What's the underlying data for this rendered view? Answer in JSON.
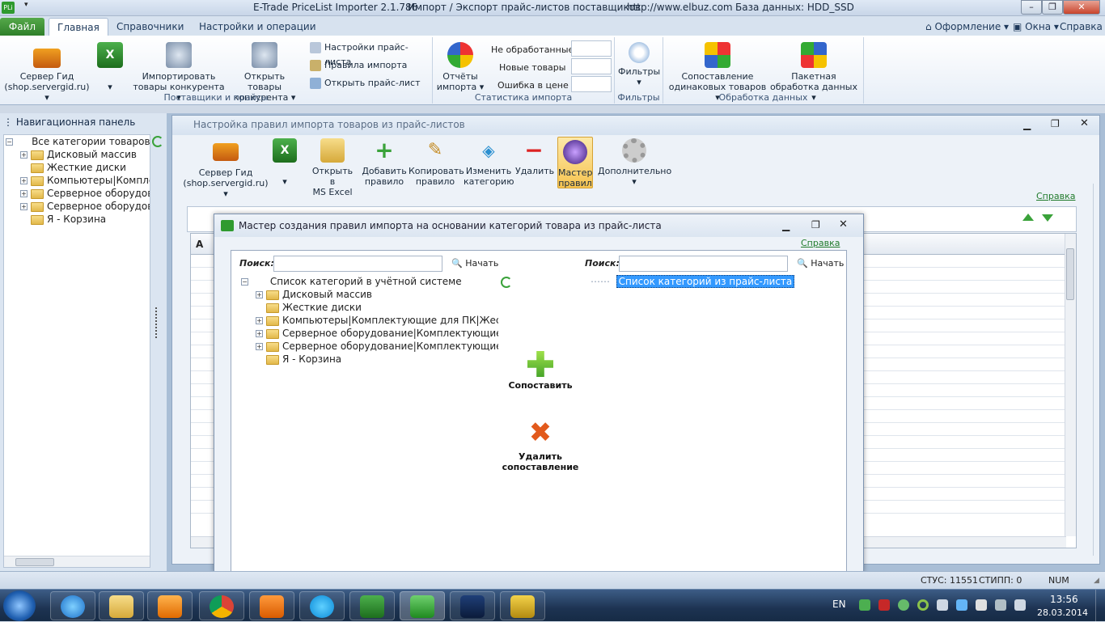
{
  "app": {
    "logo": "PLi",
    "title": "E-Trade PriceList Importer 2.1.786",
    "subtitle": "Импорт / Экспорт прайс-листов поставщиков",
    "url": "http://www.elbuz.com",
    "db": "База данных: HDD_SSD"
  },
  "tabs": {
    "file": "Файл",
    "items": [
      "Главная",
      "Справочники",
      "Настройки и операции"
    ]
  },
  "top_right": {
    "appearance": "Оформление",
    "windows": "Окна",
    "help": "Справка"
  },
  "ribbon": {
    "server_btn": [
      "Сервер Гид",
      "(shop.servergid.ru)"
    ],
    "import_comp": [
      "Импортировать",
      "товары конкурента"
    ],
    "open_comp": [
      "Открыть товары",
      "конкурента"
    ],
    "group1": "Поставщики и прайсы",
    "price_settings": "Настройки прайс-листа",
    "import_rules": "Правила импорта",
    "open_price": "Открыть прайс-лист",
    "reports": [
      "Отчёты",
      "импорта"
    ],
    "not_processed": "Не обработанные",
    "new_goods": "Новые товары",
    "price_error": "Ошибка в цене",
    "group2": "Статистика импорта",
    "filters": "Фильтры",
    "group3": "Фильтры",
    "matching": [
      "Сопоставление",
      "одинаковых товаров"
    ],
    "batch": [
      "Пакетная",
      "обработка данных"
    ],
    "group4": "Обработка данных"
  },
  "nav": {
    "header": "Навигационная панель",
    "root": "Все категории товаров",
    "items": [
      "Дисковый массив",
      "Жесткие диски",
      "Компьютеры|Комплек",
      "Серверное оборудова",
      "Серверное оборудова",
      "Я - Корзина"
    ]
  },
  "win1": {
    "title": "Настройка правил импорта товаров из прайс-листов",
    "server": [
      "Сервер Гид",
      "(shop.servergid.ru)"
    ],
    "open_excel": [
      "Открыть в",
      "MS Excel"
    ],
    "add": [
      "Добавить",
      "правило"
    ],
    "copy": [
      "Копировать",
      "правило"
    ],
    "change": [
      "Изменить",
      "категорию"
    ],
    "delete": "Удалить",
    "master": [
      "Мастер",
      "правил"
    ],
    "extra": "Дополнительно",
    "help": "Справка",
    "col_a": "A"
  },
  "win2": {
    "title": "Мастер создания правил импорта на основании категорий товара из прайс-листа",
    "help": "Справка",
    "search_label": "Поиск:",
    "start": "Начать",
    "left_root": "Список категорий в учётной системе",
    "left_items": [
      "Дисковый массив",
      "Жесткие диски",
      "Компьютеры|Комплектующие для ПК|Жестки",
      "Серверное оборудование|Комплектующие к с",
      "Серверное оборудование|Комплектующие к с",
      "Я - Корзина"
    ],
    "right_root": "Список категорий из прайс-листа",
    "match": "Сопоставить",
    "unmatch": [
      "Удалить",
      "сопоставление"
    ]
  },
  "status": {
    "stus": "СТУС: 11551",
    "stipp": "СТИПП: 0",
    "num": "NUM"
  },
  "taskbar": {
    "lang": "EN",
    "time": "13:56",
    "date": "28.03.2014"
  },
  "colors": {
    "accent": "#2f7f2a",
    "selection": "#3399ff",
    "link": "#1f7a2a"
  }
}
